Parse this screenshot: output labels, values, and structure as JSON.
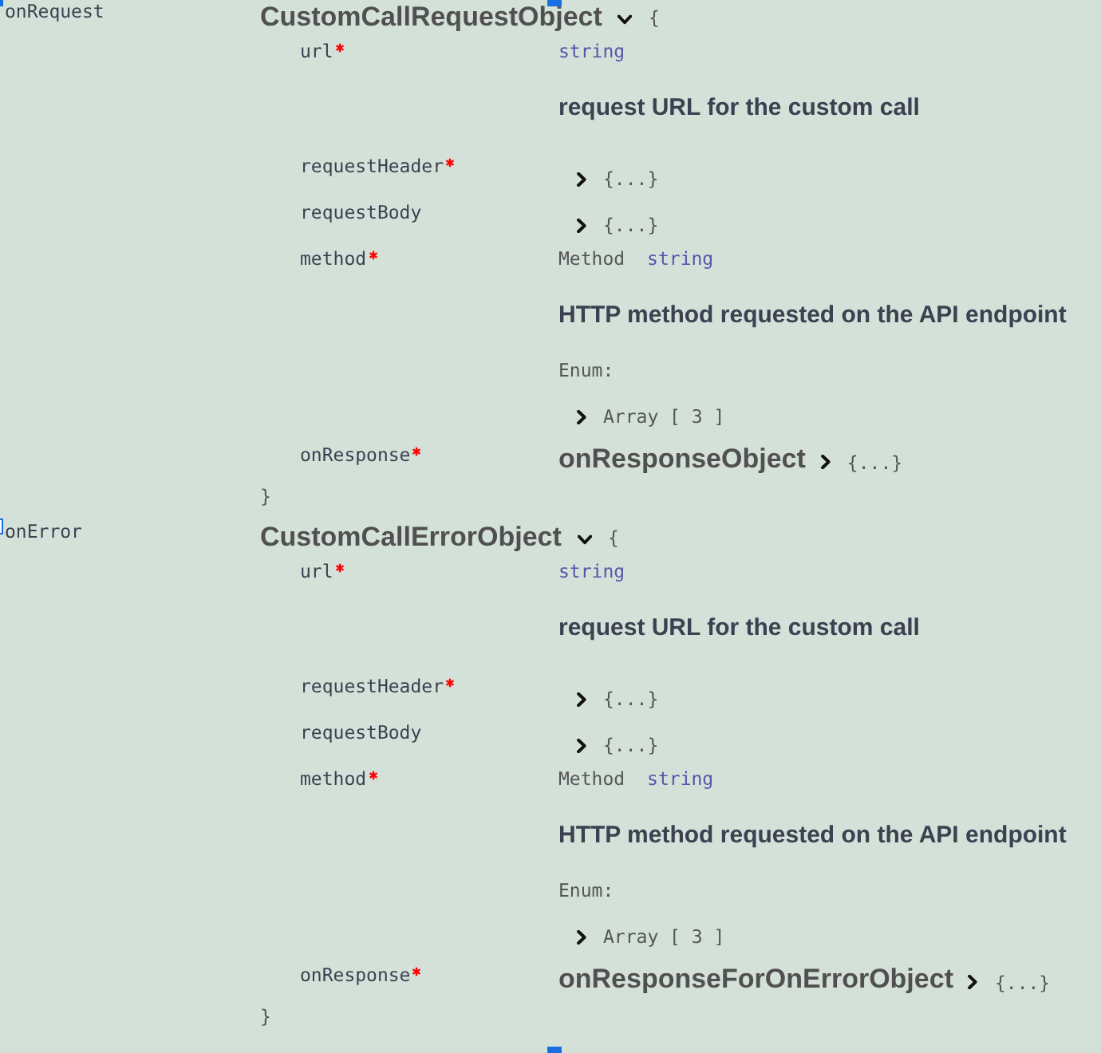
{
  "properties": [
    {
      "name": "onRequest",
      "model": {
        "title": "CustomCallRequestObject",
        "expanded": true,
        "open_brace": "{",
        "close_brace": "}",
        "fields": [
          {
            "kind": "string",
            "name": "url",
            "required": true,
            "type": "string",
            "description": "request URL for the custom call"
          },
          {
            "kind": "object",
            "name": "requestHeader",
            "required": true,
            "expanded": false,
            "summary": "{...}"
          },
          {
            "kind": "object",
            "name": "requestBody",
            "required": false,
            "expanded": false,
            "summary": "{...}"
          },
          {
            "kind": "enum",
            "name": "method",
            "required": true,
            "title": "Method",
            "type": "string",
            "description": "HTTP method requested on the API endpoint",
            "enum_label": "Enum:",
            "enum": {
              "expanded": false,
              "summary": "Array [ 3 ]"
            }
          },
          {
            "kind": "model",
            "name": "onResponse",
            "required": true,
            "title": "onResponseObject",
            "expanded": false,
            "summary": "{...}"
          }
        ]
      }
    },
    {
      "name": "onError",
      "model": {
        "title": "CustomCallErrorObject",
        "expanded": true,
        "open_brace": "{",
        "close_brace": "}",
        "fields": [
          {
            "kind": "string",
            "name": "url",
            "required": true,
            "type": "string",
            "description": "request URL for the custom call"
          },
          {
            "kind": "object",
            "name": "requestHeader",
            "required": true,
            "expanded": false,
            "summary": "{...}"
          },
          {
            "kind": "object",
            "name": "requestBody",
            "required": false,
            "expanded": false,
            "summary": "{...}"
          },
          {
            "kind": "enum",
            "name": "method",
            "required": true,
            "title": "Method",
            "type": "string",
            "description": "HTTP method requested on the API endpoint",
            "enum_label": "Enum:",
            "enum": {
              "expanded": false,
              "summary": "Array [ 3 ]"
            }
          },
          {
            "kind": "model",
            "name": "onResponse",
            "required": true,
            "title": "onResponseForOnErrorObject",
            "expanded": false,
            "summary": "{...}"
          }
        ]
      }
    }
  ]
}
